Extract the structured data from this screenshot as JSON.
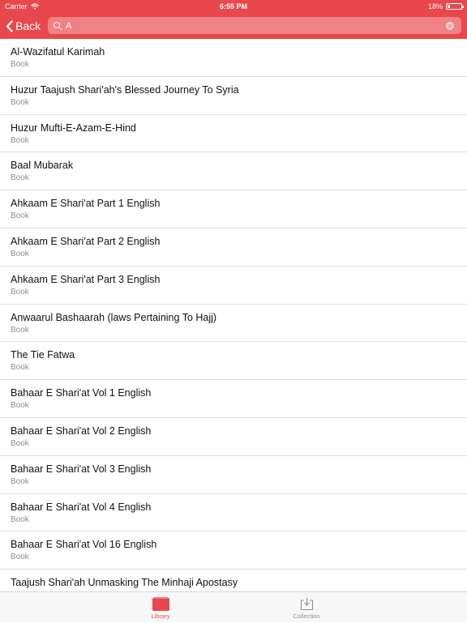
{
  "status": {
    "carrier": "Carrier",
    "time": "6:55 PM",
    "battery": "18%",
    "battery_level": 0.18
  },
  "nav": {
    "back_label": "Back",
    "search_value": "A"
  },
  "items": [
    {
      "title": "Al-Wazifatul Karimah",
      "subtitle": "Book"
    },
    {
      "title": "Huzur Taajush Shari'ah's Blessed Journey To Syria",
      "subtitle": "Book"
    },
    {
      "title": "Huzur Mufti-E-Azam-E-Hind",
      "subtitle": "Book"
    },
    {
      "title": "Baal Mubarak",
      "subtitle": "Book"
    },
    {
      "title": "Ahkaam E Shari'at Part 1 English",
      "subtitle": "Book"
    },
    {
      "title": "Ahkaam E Shari'at Part 2 English",
      "subtitle": "Book"
    },
    {
      "title": "Ahkaam E Shari'at Part 3 English",
      "subtitle": "Book"
    },
    {
      "title": "Anwaarul Bashaarah (laws Pertaining To Hajj)",
      "subtitle": "Book"
    },
    {
      "title": "The Tie Fatwa",
      "subtitle": "Book"
    },
    {
      "title": "Bahaar E Shari'at Vol 1 English",
      "subtitle": "Book"
    },
    {
      "title": "Bahaar E Shari'at Vol 2 English",
      "subtitle": "Book"
    },
    {
      "title": "Bahaar E Shari'at Vol 3 English",
      "subtitle": "Book"
    },
    {
      "title": "Bahaar E Shari'at Vol 4 English",
      "subtitle": "Book"
    },
    {
      "title": "Bahaar E Shari'at Vol 16 English",
      "subtitle": "Book"
    },
    {
      "title": "Taajush Shari'ah Unmasking The Minhaji Apostasy",
      "subtitle": ""
    }
  ],
  "tabs": {
    "library": "Library",
    "collection": "Collection"
  },
  "colors": {
    "accent": "#e8484b"
  }
}
